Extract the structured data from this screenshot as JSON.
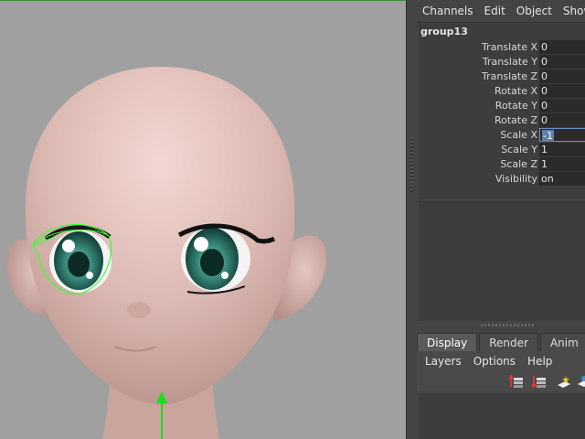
{
  "channel_box": {
    "menu": [
      "Channels",
      "Edit",
      "Object",
      "Show"
    ],
    "node_name": "group13",
    "attributes": [
      {
        "label": "Translate X",
        "value": "0"
      },
      {
        "label": "Translate Y",
        "value": "0"
      },
      {
        "label": "Translate Z",
        "value": "0"
      },
      {
        "label": "Rotate X",
        "value": "0"
      },
      {
        "label": "Rotate Y",
        "value": "0"
      },
      {
        "label": "Rotate Z",
        "value": "0"
      },
      {
        "label": "Scale X",
        "value": "-1"
      },
      {
        "label": "Scale Y",
        "value": "1"
      },
      {
        "label": "Scale Z",
        "value": "1"
      },
      {
        "label": "Visibility",
        "value": "on"
      }
    ]
  },
  "layer_editor": {
    "tabs": [
      "Display",
      "Render",
      "Anim"
    ],
    "active_tab": "Display",
    "menu": [
      "Layers",
      "Options",
      "Help"
    ],
    "tool_icons": [
      "new-layer-from-selection-icon",
      "new-empty-layer-icon",
      "create-layer-icon",
      "layer-options-icon"
    ]
  },
  "viewport": {
    "background_color": "#a0a0a0",
    "selection_color": "#39ff39",
    "manipulator_color": "#19e019"
  }
}
